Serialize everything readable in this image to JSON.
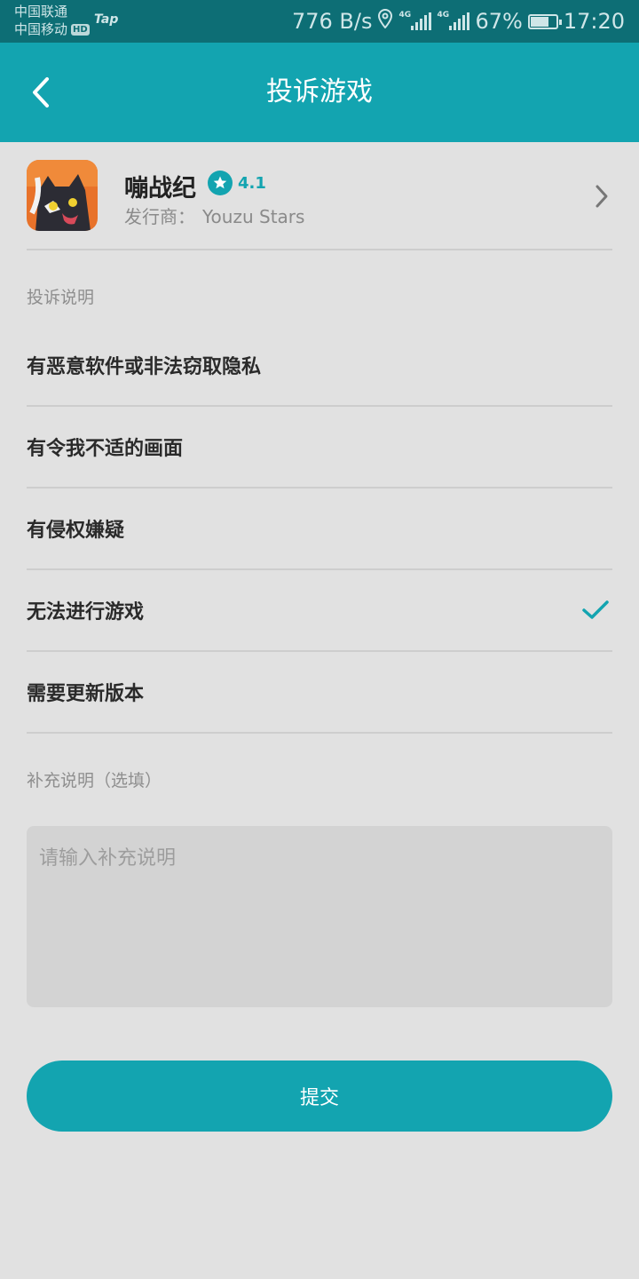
{
  "status_bar": {
    "carrier_1": "中国联通",
    "carrier_2": "中国移动",
    "hd_badge": "HD",
    "app_badge": "Tap",
    "net_speed": "776 B/s",
    "network_1": "4G",
    "network_2": "4G",
    "battery": "67%",
    "time": "17:20"
  },
  "header": {
    "title": "投诉游戏",
    "back_icon": "chevron-left-icon",
    "background": "#13a4b0"
  },
  "game": {
    "name": "嘣战纪",
    "rating": "4.1",
    "publisher_label": "发行商：",
    "publisher": "Youzu Stars",
    "rating_icon": "star-icon"
  },
  "complaint": {
    "section_label": "投诉说明",
    "reasons": [
      {
        "label": "有恶意软件或非法窃取隐私",
        "selected": false
      },
      {
        "label": "有令我不适的画面",
        "selected": false
      },
      {
        "label": "有侵权嫌疑",
        "selected": false
      },
      {
        "label": "无法进行游戏",
        "selected": true
      },
      {
        "label": "需要更新版本",
        "selected": false
      }
    ]
  },
  "notes": {
    "section_label": "补充说明（选填）",
    "placeholder": "请输入补充说明",
    "value": ""
  },
  "submit": {
    "label": "提交"
  },
  "colors": {
    "accent": "#13a4b0",
    "status_bar": "#0d6e75",
    "background": "#e1e1e1"
  }
}
